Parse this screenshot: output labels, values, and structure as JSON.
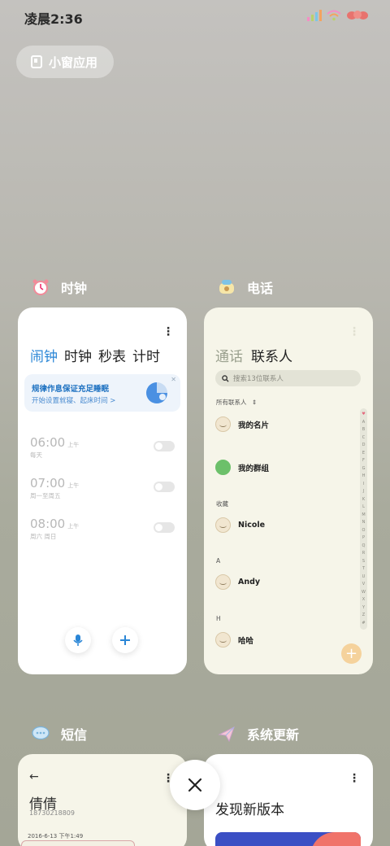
{
  "status_bar": {
    "time": "凌晨2:36"
  },
  "small_window": {
    "label": "小窗应用"
  },
  "apps": {
    "clock": {
      "name": "时钟",
      "tabs": [
        "闹钟",
        "时钟",
        "秒表",
        "计时"
      ],
      "active_tab": 0,
      "promo": {
        "title": "规律作息保证充足睡眠",
        "subtitle": "开始设置就寝、起床时间 >"
      },
      "alarms": [
        {
          "time": "06:00",
          "ampm": "上午",
          "days": "每天",
          "enabled": false
        },
        {
          "time": "07:00",
          "ampm": "上午",
          "days": "周一至周五",
          "enabled": false
        },
        {
          "time": "08:00",
          "ampm": "上午",
          "days": "周六 周日",
          "enabled": false
        }
      ]
    },
    "phone": {
      "name": "电话",
      "tabs": [
        "通话",
        "联系人"
      ],
      "active_tab": 1,
      "search_placeholder": "搜索13位联系人",
      "all_contacts_label": "所有联系人",
      "my_card": "我的名片",
      "my_group": "我的群组",
      "favorites_label": "收藏",
      "contacts": [
        {
          "section": "",
          "name": "Nicole"
        },
        {
          "section": "A",
          "name": "Andy"
        },
        {
          "section": "H",
          "name": "哈哈"
        }
      ],
      "index_letters": [
        "♥",
        "A",
        "B",
        "C",
        "D",
        "E",
        "F",
        "G",
        "H",
        "I",
        "J",
        "K",
        "L",
        "M",
        "N",
        "O",
        "P",
        "Q",
        "R",
        "S",
        "T",
        "U",
        "V",
        "W",
        "X",
        "Y",
        "Z",
        "#"
      ]
    },
    "messages": {
      "name": "短信",
      "contact_name": "倩倩",
      "phone_number": "18730218809",
      "date": "2016-6-13 下午1:49"
    },
    "update": {
      "name": "系统更新",
      "title": "发现新版本"
    }
  },
  "colors": {
    "accent_blue": "#2a86d6",
    "group_green": "#6cc06a",
    "phone_bg": "#f6f5e9"
  }
}
